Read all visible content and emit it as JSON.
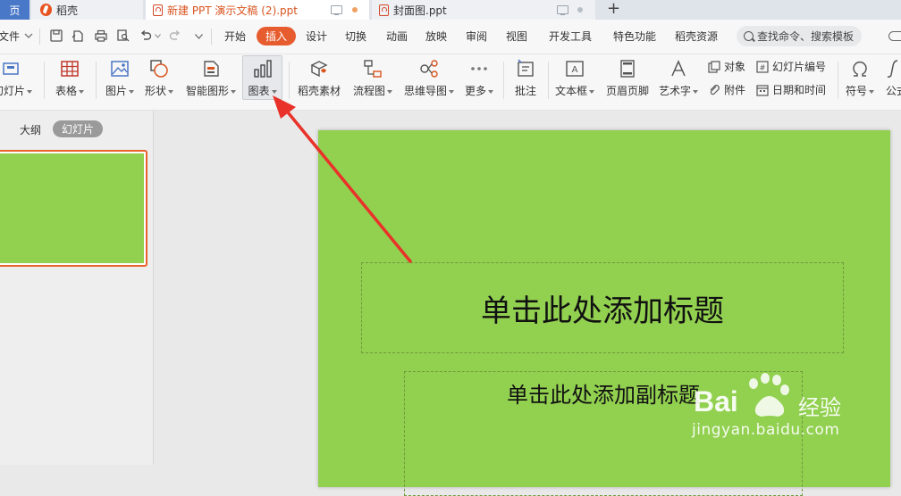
{
  "tabs": [
    {
      "label": "页"
    },
    {
      "label": "稻壳"
    },
    {
      "label": "新建 PPT 演示文稿 (2).ppt"
    },
    {
      "label": "封面图.ppt"
    }
  ],
  "menu": {
    "file": "文件",
    "items": [
      "开始",
      "插入",
      "设计",
      "切换",
      "动画",
      "放映",
      "审阅",
      "视图",
      "开发工具",
      "特色功能",
      "稻壳资源"
    ],
    "search_placeholder": "查找命令、搜索模板"
  },
  "ribbon": {
    "slide": "幻灯片",
    "table": "表格",
    "picture": "图片",
    "shape": "形状",
    "smartart": "智能图形",
    "chart": "图表",
    "daoke_material": "稻壳素材",
    "flowchart": "流程图",
    "mindmap": "思维导图",
    "more": "更多",
    "comment": "批注",
    "textbox": "文本框",
    "header_footer": "页眉页脚",
    "wordart": "艺术字",
    "object": "对象",
    "attachment": "附件",
    "slide_number": "幻灯片编号",
    "datetime": "日期和时间",
    "symbol": "符号",
    "formula": "公式"
  },
  "left_panel": {
    "outline_tab": "大纲",
    "slides_tab": "幻灯片"
  },
  "slide": {
    "title_placeholder": "单击此处添加标题",
    "subtitle_placeholder": "单击此处添加副标题",
    "background": "#92d050"
  },
  "watermark": {
    "brand": "Bai",
    "cn": "经验",
    "url": "jingyan.baidu.com"
  },
  "colors": {
    "accent": "#e75c2f",
    "arrow": "#e8322a"
  }
}
